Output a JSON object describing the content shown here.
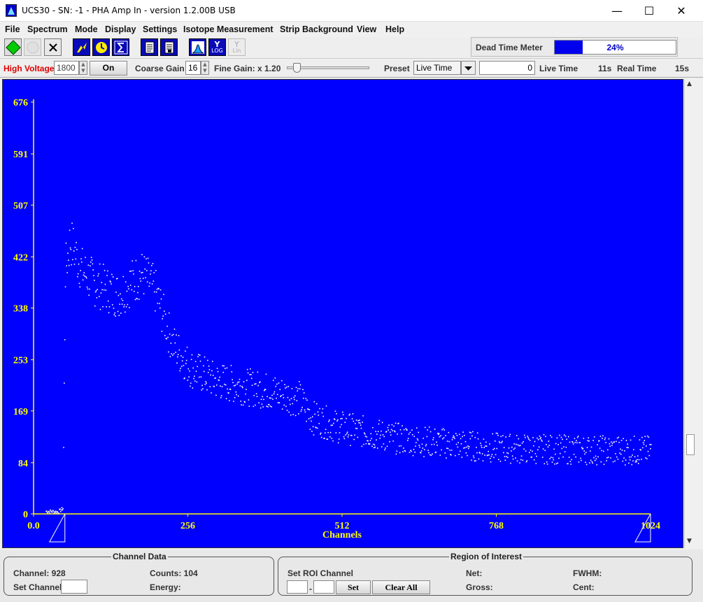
{
  "window": {
    "title": "UCS30 - SN: -1 - PHA Amp In  - version 1.2.00B USB",
    "minimize": "—",
    "maximize": "☐",
    "close": "✕"
  },
  "menu": [
    "File",
    "Spectrum",
    "Mode",
    "Display",
    "Settings",
    "Isotope Measurement",
    "Strip Background",
    "View",
    "Help"
  ],
  "toolbar": {
    "buttons": [
      "start-icon",
      "stop-icon",
      "clear-icon",
      "auto-calibrate-icon",
      "timer-icon",
      "sum-icon",
      "report-icon",
      "report-alt-icon",
      "spectrum-view-icon",
      "log-scale-icon",
      "lin-scale-icon"
    ],
    "log_label": "LOG",
    "lin_label": "Lin",
    "y_label": "Y"
  },
  "dead_time": {
    "label": "Dead Time Meter",
    "value": "24%",
    "fraction": 0.24
  },
  "controls": {
    "high_voltage_label": "High Voltage",
    "high_voltage_value": "1800",
    "hv_button": "On",
    "coarse_gain_label": "Coarse Gain",
    "coarse_gain_value": "16",
    "fine_gain_label": "Fine Gain: x 1.20",
    "fine_gain_fraction": 0.08,
    "preset_label": "Preset",
    "preset_value": "Live Time",
    "preset_input": "0",
    "live_time_label": "Live Time",
    "live_time_value": "11s",
    "real_time_label": "Real Time",
    "real_time_value": "15s"
  },
  "chart_data": {
    "type": "scatter",
    "xlabel": "Channels",
    "ylabel": "",
    "xlim": [
      0,
      1024
    ],
    "ylim": [
      0,
      676
    ],
    "x_ticks": [
      "0.0",
      "256",
      "512",
      "768",
      "1024"
    ],
    "y_ticks": [
      "0",
      "84",
      "169",
      "253",
      "338",
      "422",
      "507",
      "591",
      "676"
    ],
    "colors": {
      "background": "#0000ff",
      "axis": "#ffff00",
      "points": "#ffffff"
    },
    "roi_markers": [
      52,
      1024
    ],
    "profile": {
      "channels": [
        20,
        30,
        40,
        48,
        52,
        60,
        80,
        100,
        120,
        140,
        160,
        180,
        200,
        230,
        260,
        300,
        350,
        400,
        440,
        460,
        500,
        550,
        600,
        650,
        700,
        750,
        800,
        850,
        900,
        1024
      ],
      "counts": [
        5,
        5,
        4,
        10,
        400,
        450,
        400,
        380,
        370,
        360,
        380,
        395,
        370,
        280,
        240,
        220,
        210,
        200,
        190,
        160,
        145,
        135,
        125,
        120,
        115,
        110,
        108,
        107,
        106,
        105
      ]
    }
  },
  "channel_data": {
    "title": "Channel Data",
    "channel_label": "Channel: 928",
    "counts_label": "Counts:  104",
    "set_channel_label": "Set Channel",
    "energy_label": "Energy:"
  },
  "roi": {
    "title": "Region of Interest",
    "set_roi_label": "Set ROI Channel",
    "dash": "-",
    "set_button": "Set",
    "clear_all_button": "Clear All",
    "net_label": "Net:",
    "fwhm_label": "FWHM:",
    "gross_label": "Gross:",
    "cent_label": "Cent:"
  }
}
